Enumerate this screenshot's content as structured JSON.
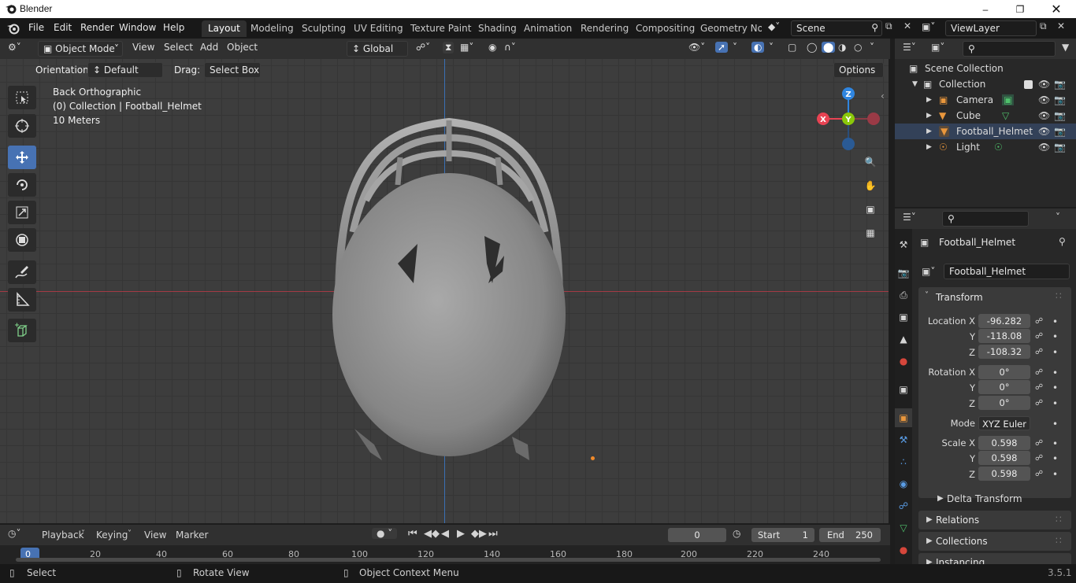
{
  "window": {
    "title": "Blender"
  },
  "menu": [
    "File",
    "Edit",
    "Render",
    "Window",
    "Help"
  ],
  "workspaces": [
    "Layout",
    "Modeling",
    "Sculpting",
    "UV Editing",
    "Texture Paint",
    "Shading",
    "Animation",
    "Rendering",
    "Compositing",
    "Geometry Noc"
  ],
  "scene": "Scene",
  "view_layer": "ViewLayer",
  "viewport_header": {
    "mode": "Object Mode",
    "view": "View",
    "select": "Select",
    "add": "Add",
    "object": "Object",
    "orientation_transform": "Global"
  },
  "tool_settings": {
    "orientation_label": "Orientation:",
    "orientation_value": "Default",
    "drag_label": "Drag:",
    "drag_value": "Select Box",
    "options": "Options"
  },
  "viewport_info": {
    "view_name": "Back Orthographic",
    "collection": "(0) Collection | Football_Helmet",
    "scale": "10 Meters"
  },
  "gizmo": {
    "z": "Z",
    "y": "Y",
    "x": "X"
  },
  "outliner": {
    "root": "Scene Collection",
    "collection": "Collection",
    "items": [
      {
        "name": "Camera",
        "icon": "camera-icon"
      },
      {
        "name": "Cube",
        "icon": "mesh-icon"
      },
      {
        "name": "Football_Helmet",
        "icon": "mesh-icon"
      },
      {
        "name": "Light",
        "icon": "light-icon"
      }
    ]
  },
  "properties": {
    "object_name": "Football_Helmet",
    "datablock_name": "Football_Helmet",
    "transform_title": "Transform",
    "location_label": "Location X",
    "loc_x": "-96.282",
    "loc_y": "-118.08",
    "loc_z": "-108.32",
    "rotation_label": "Rotation X",
    "rot_x": "0°",
    "rot_y": "0°",
    "rot_z": "0°",
    "mode_label": "Mode",
    "mode_value": "XYZ Euler",
    "scale_label": "Scale X",
    "scale_x": "0.598",
    "scale_y": "0.598",
    "scale_z": "0.598",
    "y_label": "Y",
    "z_label": "Z",
    "delta": "Delta Transform",
    "relations": "Relations",
    "collections": "Collections",
    "instancing": "Instancing"
  },
  "timeline": {
    "playback": "Playback",
    "keying": "Keying",
    "view": "View",
    "marker": "Marker",
    "current_frame": "0",
    "start_label": "Start",
    "start": "1",
    "end_label": "End",
    "end": "250",
    "ticks": [
      "0",
      "20",
      "40",
      "60",
      "80",
      "100",
      "120",
      "140",
      "160",
      "180",
      "200",
      "220",
      "240"
    ]
  },
  "status": {
    "select": "Select",
    "rotate": "Rotate View",
    "context": "Object Context Menu",
    "version": "3.5.1"
  },
  "colors": {
    "accent": "#4772b3",
    "x_axis": "#e84353",
    "y_axis": "#8bc80a",
    "z_axis": "#2f85e0",
    "frame_marker": "#4772b3"
  }
}
